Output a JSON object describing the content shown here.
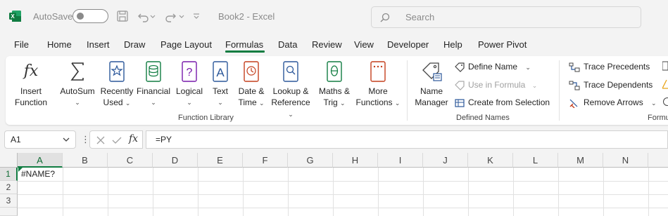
{
  "titlebar": {
    "autosave_label": "AutoSave",
    "autosave_state": "Off",
    "doc_title": "Book2  -  Excel",
    "search_placeholder": "Search"
  },
  "menu": [
    "File",
    "Home",
    "Insert",
    "Draw",
    "Page Layout",
    "Formulas",
    "Data",
    "Review",
    "View",
    "Developer",
    "Help",
    "Power Pivot"
  ],
  "active_menu": "Formulas",
  "ribbon": {
    "insert_function": [
      "Insert",
      "Function"
    ],
    "autosum": "AutoSum",
    "recently_used": [
      "Recently",
      "Used"
    ],
    "financial": "Financial",
    "logical": "Logical",
    "text": "Text",
    "date_time": [
      "Date &",
      "Time"
    ],
    "lookup": [
      "Lookup &",
      "Reference"
    ],
    "maths": [
      "Maths &",
      "Trig"
    ],
    "more": [
      "More",
      "Functions"
    ],
    "function_library_label": "Function Library",
    "name_manager": [
      "Name",
      "Manager"
    ],
    "define_name": "Define Name",
    "use_in_formula": "Use in Formula",
    "create_from_selection": "Create from Selection",
    "defined_names_label": "Defined Names",
    "trace_precedents": "Trace Precedents",
    "trace_dependents": "Trace Dependents",
    "remove_arrows": "Remove Arrows",
    "formula_auditing_label": "Formu"
  },
  "formula_bar": {
    "name_box": "A1",
    "fx": "fx",
    "content": "=PY"
  },
  "grid": {
    "columns": [
      "A",
      "B",
      "C",
      "D",
      "E",
      "F",
      "G",
      "H",
      "I",
      "J",
      "K",
      "L",
      "M",
      "N"
    ],
    "rows": [
      "1",
      "2",
      "3"
    ],
    "a1_value": "#NAME?"
  },
  "colors": {
    "accent": "#107c41",
    "icon_blue": "#2b579a",
    "icon_red": "#c43e1c",
    "icon_purple": "#7719aa",
    "icon_green": "#107c41"
  }
}
